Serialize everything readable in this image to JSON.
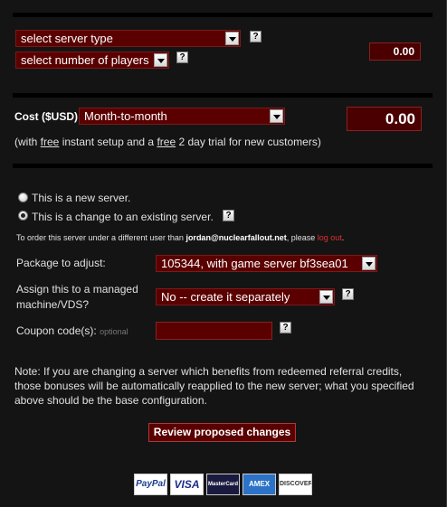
{
  "server": {
    "type_select": "select server type",
    "players_select": "select number of players",
    "subtotal": "0.00"
  },
  "cost": {
    "label": "Cost ($USD)",
    "term_select": "Month-to-month",
    "total": "0.00",
    "note_prefix": "(with ",
    "note_free1": "free",
    "note_mid": " instant setup and a ",
    "note_free2": "free",
    "note_suffix": " 2 day trial for new customers)"
  },
  "server_choice": {
    "new_label": "This is a new server.",
    "change_label": "This is a change to an existing server."
  },
  "user_notice": {
    "prefix": "To order this server under a different user than ",
    "email": "jordan@nuclearfallout.net",
    "middle": ", please ",
    "logout": "log out",
    "suffix": "."
  },
  "form": {
    "package_label": "Package to adjust:",
    "package_value": "105344, with game server bf3sea01",
    "assign_label_line1": "Assign this to a managed",
    "assign_label_line2": "machine/VDS?",
    "assign_value": "No -- create it separately",
    "coupon_label": "Coupon code(s):",
    "coupon_optional": "optional"
  },
  "note": {
    "line1": "Note: If you are changing a server which benefits from redeemed referral credits,",
    "line2": "those bonuses will be automatically reapplied to the new server; what you specified",
    "line3": "above should be the base configuration."
  },
  "review_button": "Review proposed changes",
  "help_glyph": "?",
  "payment_icons": [
    "PayPal",
    "VISA",
    "MasterCard",
    "AMEX",
    "DISCOVER"
  ],
  "colors": {
    "accent": "#5a0000",
    "background": "#141414",
    "link": "#e03030"
  }
}
